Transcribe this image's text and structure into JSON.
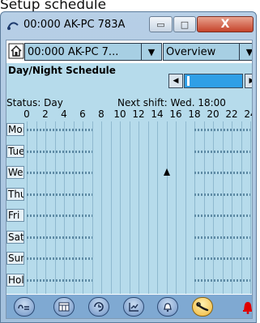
{
  "page_heading": "Setup schedule",
  "window": {
    "title": "00:000 AK-PC 783A",
    "minimize_symbol": "▭",
    "maximize_symbol": "□",
    "close_symbol": "X"
  },
  "toolbar": {
    "device_select_value": "00:000 AK-PC 7...",
    "view_select_value": "Overview",
    "dropdown_arrow": "▼"
  },
  "schedule": {
    "title": "Day/Night Schedule",
    "prev_symbol": "◀",
    "next_symbol": "▶",
    "status_text": "Status: Day",
    "next_shift_text": "Next shift: Wed. 18:00",
    "hour_labels": [
      "0",
      "2",
      "4",
      "6",
      "8",
      "10",
      "12",
      "14",
      "16",
      "18",
      "20",
      "22",
      "24"
    ],
    "days": [
      "Mon",
      "Tue",
      "Wed",
      "Thu",
      "Fri",
      "Sat",
      "Sun",
      "Hol"
    ],
    "night_hours": {
      "start": 7,
      "end": 18
    },
    "current_marker": {
      "day": "Wed",
      "hour": 15
    }
  },
  "bottom_bar": {
    "icons": [
      "refrigerator-icon",
      "calendar-icon",
      "schedule-icon",
      "graph-icon",
      "bell-icon",
      "wrench-icon"
    ],
    "active_icon": "wrench-icon"
  },
  "colors": {
    "panel": "#b6dbeb",
    "dropdown": "#a7cfe3",
    "selection": "#2f9fe6",
    "alarm": "#e00000"
  }
}
